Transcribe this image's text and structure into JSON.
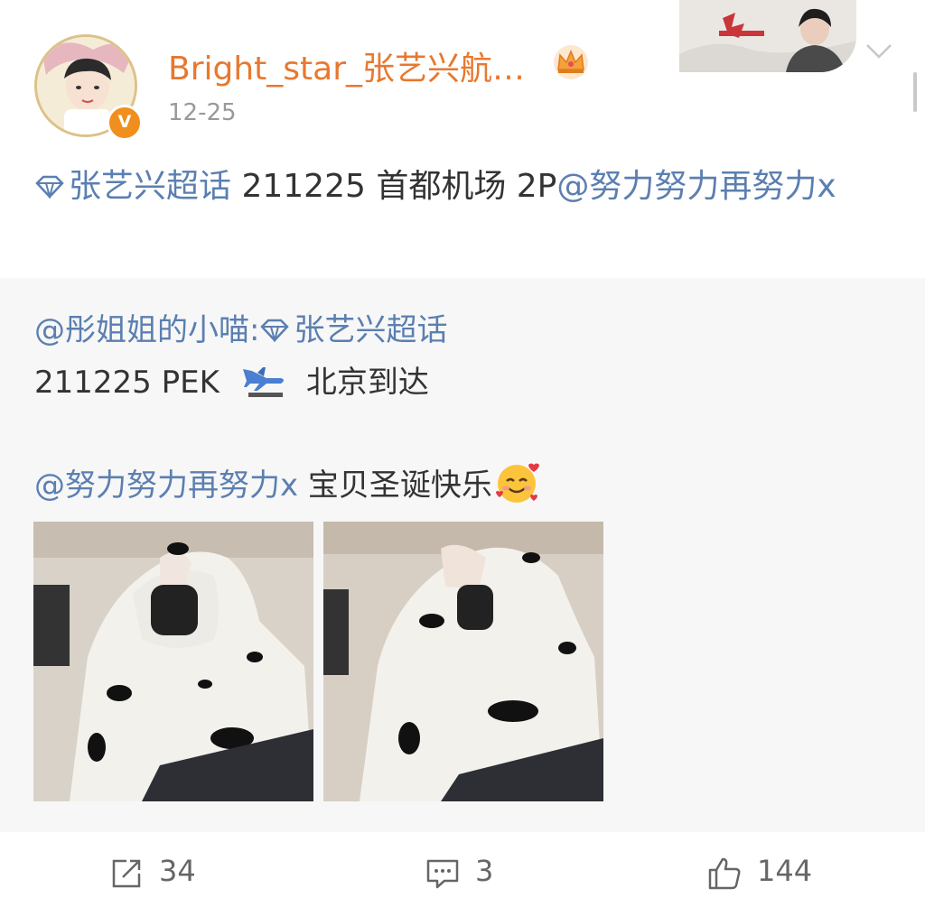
{
  "post": {
    "username": "Bright_star_张艺兴航…",
    "timestamp": "12-25",
    "verify_badge": "V",
    "text": {
      "topic": "张艺兴超话",
      "body": " 211225 首都机场 2P",
      "mention": "@努力努力再努力x"
    }
  },
  "repost": {
    "author": "@彤姐姐的小喵:",
    "topic": "张艺兴超话",
    "line2_prefix": "211225  PEK",
    "line2_suffix": "北京到达",
    "mention": "@努力努力再努力x",
    "greeting": " 宝贝圣诞快乐"
  },
  "actions": {
    "repost_count": "34",
    "comment_count": "3",
    "like_count": "144"
  },
  "colors": {
    "link": "#5b7fb0",
    "username": "#e8782f",
    "badge": "#f08f1e"
  },
  "icons": [
    "crown-icon",
    "chevron-down-icon",
    "diamond-topic-icon",
    "airplane-arrival-icon",
    "smiling-face-with-hearts-icon",
    "share-icon",
    "comment-icon",
    "like-icon"
  ]
}
